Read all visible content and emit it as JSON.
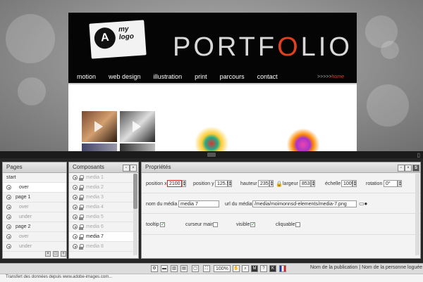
{
  "site": {
    "logo_mark": "A",
    "logo_text": "my logo",
    "title_a": "PORTF",
    "title_b": "O",
    "title_c": "LIO",
    "nav": [
      "motion",
      "web design",
      "illustration",
      "print",
      "parcours",
      "contact"
    ],
    "home_prefix": ">>>>>",
    "home_label": "home"
  },
  "pages_panel": {
    "title": "Pages",
    "rows": [
      {
        "label": "start",
        "type": "top"
      },
      {
        "label": "over",
        "type": "sub",
        "selected": true
      },
      {
        "label": "page 1",
        "type": "top"
      },
      {
        "label": "over",
        "type": "sub"
      },
      {
        "label": "under",
        "type": "sub"
      },
      {
        "label": "page 2",
        "type": "top"
      },
      {
        "label": "over",
        "type": "sub"
      },
      {
        "label": "under",
        "type": "sub"
      }
    ]
  },
  "components_panel": {
    "title": "Composants",
    "items": [
      "media 1",
      "media 2",
      "media 3",
      "media 4",
      "media 5",
      "media 6",
      "media 7",
      "media 8"
    ],
    "selected_index": 6
  },
  "properties_panel": {
    "title": "Propriétés",
    "position_x_label": "position x",
    "position_x": "2100",
    "position_y_label": "position y",
    "position_y": "125.5",
    "hauteur_label": "hauteur",
    "hauteur": "235",
    "largeur_label": "largeur",
    "largeur": "853",
    "echelle_label": "échelle",
    "echelle": "100%",
    "rotation_label": "rotation",
    "rotation": "0°",
    "nom_label": "nom du média",
    "nom": "media 7",
    "url_label": "url du média",
    "url": "/media/moimonnsd-elements/media-7.png",
    "tooltip_label": "tooltip",
    "tooltip_checked": true,
    "curseur_label": "curseur main",
    "curseur_checked": false,
    "visible_label": "visible",
    "visible_checked": true,
    "cliquable_label": "cliquable",
    "cliquable_checked": false
  },
  "toolbar": {
    "zoom": "100%",
    "publication": "Nom de la publication",
    "separator": "|",
    "user": "Nom de la personne loguée"
  },
  "status": {
    "text": "Transfert des données depuis www.adobe-images.com..."
  },
  "colors": {
    "accent": "#e04020",
    "check": "#22aa22",
    "focus_border": "#dd2222"
  }
}
